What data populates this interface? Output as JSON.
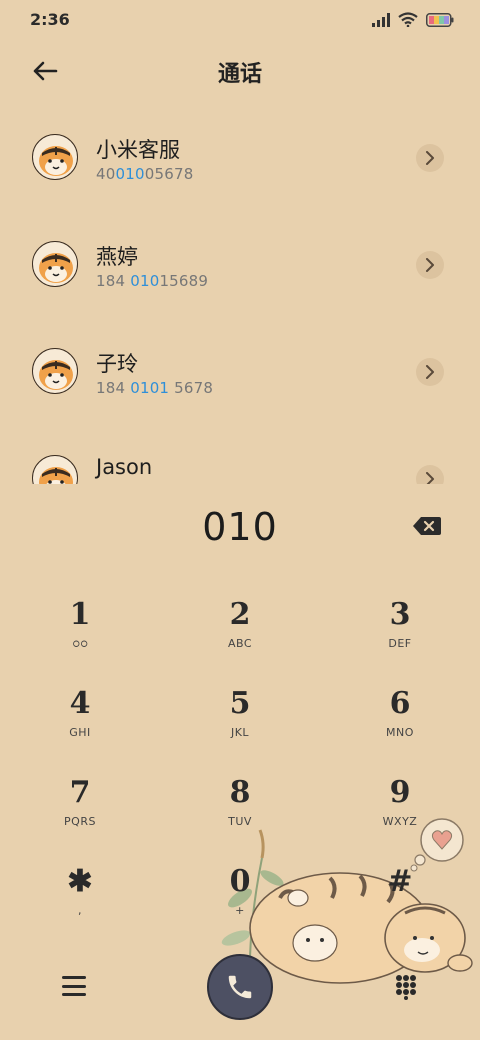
{
  "status_bar": {
    "time": "2:36",
    "icons": [
      "signal-icon",
      "wifi-icon",
      "battery-icon"
    ]
  },
  "header": {
    "back_icon": "back-arrow-icon",
    "title": "通话"
  },
  "contacts": [
    {
      "name": "小米客服",
      "number_pre": "40",
      "number_match": "010",
      "number_post": "05678"
    },
    {
      "name": "燕婷",
      "number_pre": "184 ",
      "number_match": "010",
      "number_post": "15689"
    },
    {
      "name": "子玲",
      "number_pre": "184 ",
      "number_match": "0101",
      "number_post": " 5678"
    },
    {
      "name": "Jason",
      "number_pre": "",
      "number_match": "",
      "number_post": ""
    }
  ],
  "dial_input": "010",
  "keypad": [
    {
      "digit": "1",
      "letters": "ഠഠ"
    },
    {
      "digit": "2",
      "letters": "ABC"
    },
    {
      "digit": "3",
      "letters": "DEF"
    },
    {
      "digit": "4",
      "letters": "GHI"
    },
    {
      "digit": "5",
      "letters": "JKL"
    },
    {
      "digit": "6",
      "letters": "MNO"
    },
    {
      "digit": "7",
      "letters": "PQRS"
    },
    {
      "digit": "8",
      "letters": "TUV"
    },
    {
      "digit": "9",
      "letters": "WXYZ"
    },
    {
      "digit": "✱",
      "letters": ","
    },
    {
      "digit": "0",
      "letters": "+"
    },
    {
      "digit": "#",
      "letters": ""
    }
  ],
  "bottom_bar": {
    "menu_icon": "menu-icon",
    "call_icon": "phone-icon",
    "keypad_icon": "dialpad-icon"
  },
  "colors": {
    "background": "#e8d1ae",
    "match_highlight": "#2f8fd8",
    "call_button": "#4d5063"
  }
}
